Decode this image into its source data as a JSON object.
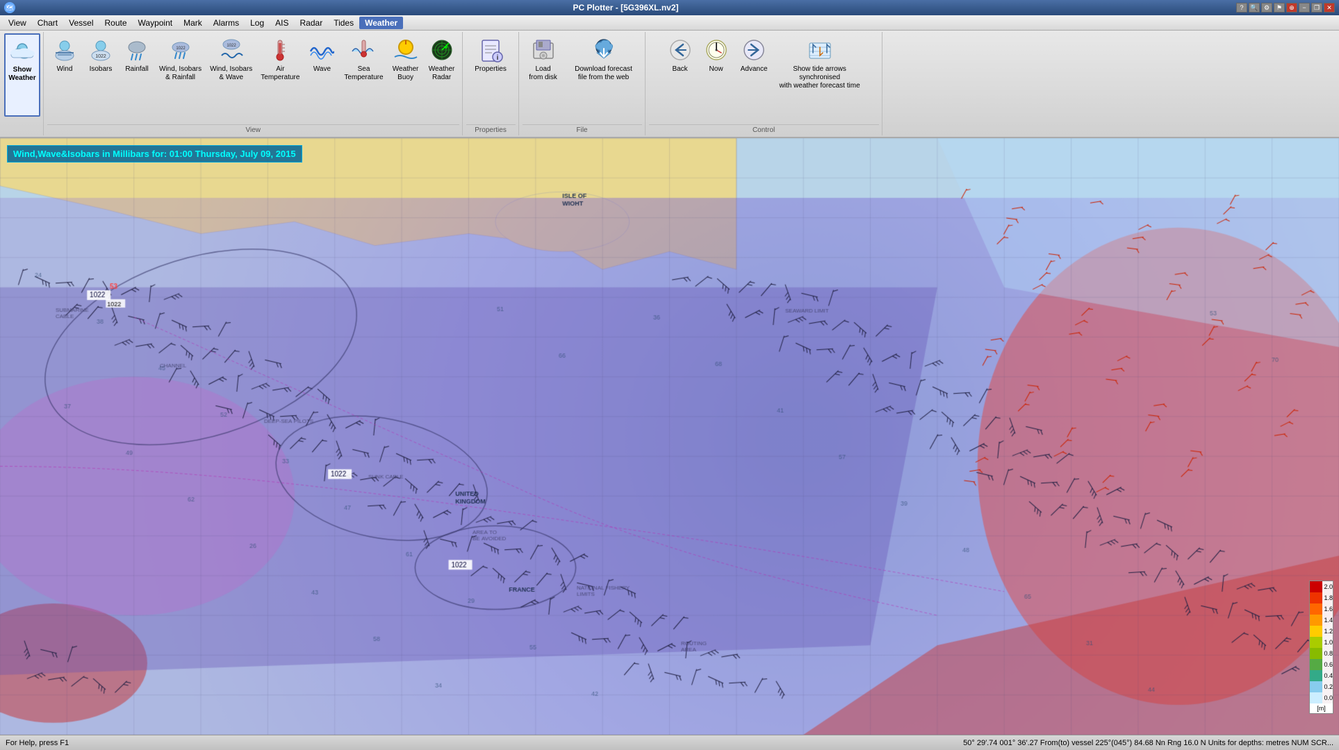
{
  "titlebar": {
    "title": "PC Plotter - [5G396XL.nv2]",
    "controls": {
      "minimize": "−",
      "restore": "❐",
      "close": "✕"
    },
    "other_controls_right": [
      "?",
      "🔍",
      "⚙",
      "⚑",
      "🚑",
      "-",
      "□",
      "✕"
    ]
  },
  "menubar": {
    "items": [
      "View",
      "Chart",
      "Vessel",
      "Route",
      "Waypoint",
      "Mark",
      "Alarms",
      "Log",
      "AIS",
      "Radar",
      "Tides",
      "Weather"
    ]
  },
  "toolbar": {
    "groups": [
      {
        "id": "show-weather",
        "buttons": [
          {
            "id": "show-weather-btn",
            "label": "Show\nWeather",
            "icon": "cloud-sun",
            "active": true
          }
        ],
        "group_label": ""
      },
      {
        "id": "view-group",
        "buttons": [
          {
            "id": "wind-btn",
            "label": "Wind",
            "icon": "wind"
          },
          {
            "id": "isobars-btn",
            "label": "Isobars",
            "icon": "isobars"
          },
          {
            "id": "rainfall-btn",
            "label": "Rainfall",
            "icon": "rainfall"
          },
          {
            "id": "wind-isobars-rainfall-btn",
            "label": "Wind, Isobars\n& Rainfall",
            "icon": "wind-isobars-rainfall"
          },
          {
            "id": "wind-isobars-wave-btn",
            "label": "Wind, Isobars\n& Wave",
            "icon": "wind-isobars-wave"
          },
          {
            "id": "air-temp-btn",
            "label": "Air\nTemperature",
            "icon": "air-temp"
          },
          {
            "id": "wave-btn",
            "label": "Wave",
            "icon": "wave"
          },
          {
            "id": "sea-temp-btn",
            "label": "Sea\nTemperature",
            "icon": "sea-temp"
          },
          {
            "id": "weather-buoy-btn",
            "label": "Weather\nBuoy",
            "icon": "weather-buoy"
          },
          {
            "id": "weather-radar-btn",
            "label": "Weather\nRadar",
            "icon": "weather-radar"
          }
        ],
        "group_label": "View"
      },
      {
        "id": "properties-group",
        "buttons": [
          {
            "id": "properties-btn",
            "label": "Properties",
            "icon": "properties"
          }
        ],
        "group_label": "Properties"
      },
      {
        "id": "file-group",
        "buttons": [
          {
            "id": "load-disk-btn",
            "label": "Load\nfrom disk",
            "icon": "load-disk"
          },
          {
            "id": "download-forecast-btn",
            "label": "Download forecast\nfile from the web",
            "icon": "download-forecast",
            "wide": true
          }
        ],
        "group_label": "File"
      },
      {
        "id": "control-group",
        "buttons": [
          {
            "id": "back-btn",
            "label": "Back",
            "icon": "back"
          },
          {
            "id": "now-btn",
            "label": "Now",
            "icon": "now"
          },
          {
            "id": "advance-btn",
            "label": "Advance",
            "icon": "advance"
          },
          {
            "id": "show-tide-arrows-btn",
            "label": "Show tide arrows synchronised\nwith weather forecast time",
            "icon": "tide-arrows",
            "wide": true
          }
        ],
        "group_label": "Control"
      }
    ]
  },
  "map": {
    "info_box": "Wind,Wave&Isobars in Millibars for: 01:00 Thursday, July 09, 2015",
    "isobar_labels": [
      "1022",
      "1022",
      "1022",
      "1022"
    ],
    "legend": {
      "title": "[m]",
      "items": [
        {
          "value": "2.0",
          "color": "#e00000"
        },
        {
          "value": "1.8",
          "color": "#ff4000"
        },
        {
          "value": "1.6",
          "color": "#ff8000"
        },
        {
          "value": "1.4",
          "color": "#ffb000"
        },
        {
          "value": "1.2",
          "color": "#ffdd00"
        },
        {
          "value": "1.0",
          "color": "#aacc00"
        },
        {
          "value": "0.8",
          "color": "#88bb00"
        },
        {
          "value": "0.6",
          "color": "#66aa44"
        },
        {
          "value": "0.4",
          "color": "#44aa88"
        },
        {
          "value": "0.2",
          "color": "#88ccee"
        },
        {
          "value": "0.0",
          "color": "#cceeff"
        }
      ]
    }
  },
  "statusbar": {
    "left": "For Help, press F1",
    "right": "50° 29′.74 001° 36′.27 From(to) vessel 225°(045°) 84.68 Nn  Rng  16.0 N  Units for depths: metres  NUM  SCR..."
  }
}
